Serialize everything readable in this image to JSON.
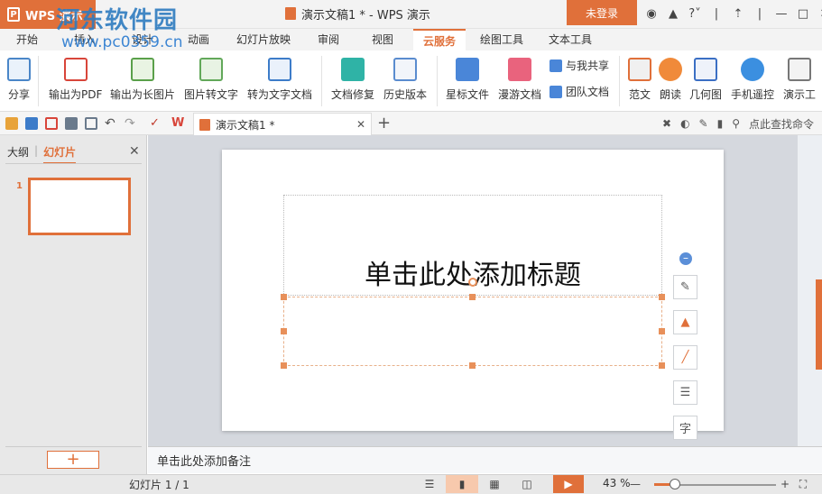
{
  "app": {
    "name": "WPS 演示",
    "window_title": "演示文稿1 * - WPS 演示",
    "login": "未登录"
  },
  "watermark": {
    "line1": "河东软件园",
    "line2": "www.pc0359.cn"
  },
  "menu_tabs": [
    "开始",
    "插入",
    "设计",
    "动画",
    "幻灯片放映",
    "审阅",
    "视图",
    "云服务",
    "绘图工具",
    "文本工具"
  ],
  "active_tab": "云服务",
  "ribbon": {
    "share": "分享",
    "export_pdf": "输出为PDF",
    "export_long_image": "输出为长图片",
    "image_to_text": "图片转文字",
    "to_text_doc": "转为文字文档",
    "doc_repair": "文档修复",
    "history": "历史版本",
    "starred": "星标文件",
    "roaming": "漫游文档",
    "shared_with_me": "与我共享",
    "team_docs": "团队文档",
    "templates": "范文",
    "read_aloud": "朗读",
    "geometry": "几何图",
    "phone_remote": "手机遥控",
    "more": "演示工"
  },
  "doc_tab": {
    "title": "演示文稿1 *"
  },
  "search_command": "点此查找命令",
  "left_panel": {
    "tab_outline": "大纲",
    "tab_slides": "幻灯片",
    "slide_number": "1"
  },
  "slide": {
    "title_placeholder": "单击此处添加标题"
  },
  "notes_placeholder": "单击此处添加备注",
  "status": {
    "slide_info": "幻灯片 1 / 1",
    "zoom": "43 %",
    "zoom_fraction": 0.17
  },
  "colors": {
    "accent": "#e0703a",
    "canvas_bg": "#d5d8de"
  },
  "float_toolbar_icons": [
    "minus-icon",
    "edit-shape-icon",
    "fill-icon",
    "outline-icon",
    "layers-icon",
    "text-icon"
  ]
}
